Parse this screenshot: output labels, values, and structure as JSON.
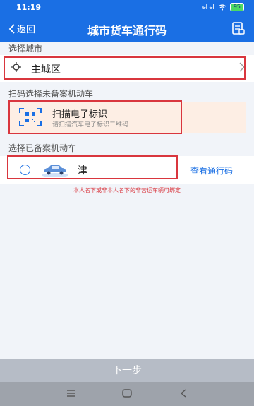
{
  "status": {
    "time": "11:19",
    "signal": "ᵴl ᵴl",
    "battery": "95"
  },
  "nav": {
    "back_label": "返回",
    "title": "城市货车通行码"
  },
  "city": {
    "section_label": "选择城市",
    "value": "主城区"
  },
  "scan": {
    "section_label": "扫码选择未备案机动车",
    "title": "扫描电子标识",
    "subtitle": "请扫描汽车电子标识二维码"
  },
  "vehicle": {
    "section_label": "选择已备案机动车",
    "plate": "津",
    "view_label": "查看通行码"
  },
  "note": "本人名下或非本人名下的非营运车辆可绑定",
  "footer": {
    "next_label": "下一步"
  },
  "colors": {
    "primary": "#1a6fe4",
    "highlight": "#d9363e",
    "scan_bg": "#fdeee4"
  }
}
